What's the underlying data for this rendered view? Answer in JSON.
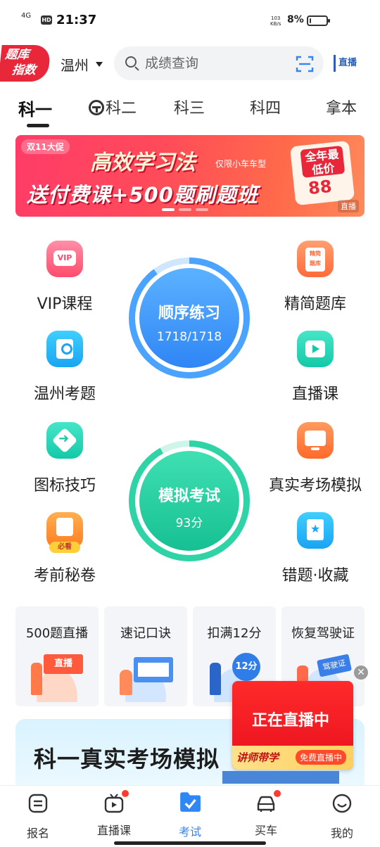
{
  "status_bar": {
    "network": "4G",
    "hd": "HD",
    "time": "21:37",
    "speed_value": "103",
    "speed_unit": "KB/s",
    "battery_pct": "8%",
    "battery_level": 0.08
  },
  "header": {
    "logo_line1": "题库",
    "logo_line2": "指数",
    "city": "温州",
    "search_placeholder": "成绩查询",
    "live_badge": "直播"
  },
  "tabs": [
    {
      "label": "科一",
      "active": true
    },
    {
      "label": "科二",
      "active": false
    },
    {
      "label": "科三",
      "active": false
    },
    {
      "label": "科四",
      "active": false
    },
    {
      "label": "拿本",
      "active": false
    }
  ],
  "banner": {
    "promo_tag": "双11大促",
    "headline": "高效学习法",
    "sub": "仅限小车车型",
    "main_line": "送付费课+500题刷题班",
    "price_title": "全年最低价",
    "price_value": "88",
    "live_mini": "直播"
  },
  "grid": {
    "vip": "VIP课程",
    "jingjian": "精简题库",
    "wenzhou": "温州考题",
    "zhibo": "直播课",
    "tubiao": "图标技巧",
    "zhenshi": "真实考场模拟",
    "kaoqian": "考前秘卷",
    "kaoqian_badge": "必看",
    "cuoti": "错题·收藏"
  },
  "practice": {
    "title": "顺序练习",
    "progress": "1718/1718",
    "done": 1718,
    "total": 1718
  },
  "exam": {
    "title": "模拟考试",
    "score": "93分"
  },
  "cards": [
    {
      "title": "500题直播",
      "art": "直播"
    },
    {
      "title": "速记口诀",
      "art": ""
    },
    {
      "title": "扣满12分",
      "art": "12分"
    },
    {
      "title": "恢复驾驶证",
      "art": "驾驶证"
    }
  ],
  "promo": {
    "title": "科一真实考场模拟"
  },
  "float_live": {
    "head": "正在直播中",
    "teacher": "讲师带学",
    "free": "免费直播中",
    "close": "✕"
  },
  "nav": [
    {
      "label": "报名",
      "icon": "signup-icon",
      "active": false,
      "dot": false
    },
    {
      "label": "直播课",
      "icon": "live-tv-icon",
      "active": false,
      "dot": true
    },
    {
      "label": "考试",
      "icon": "exam-folder-icon",
      "active": true,
      "dot": false
    },
    {
      "label": "买车",
      "icon": "car-icon",
      "active": false,
      "dot": true
    },
    {
      "label": "我的",
      "icon": "smile-icon",
      "active": false,
      "dot": false
    }
  ],
  "colors": {
    "accent": "#2f86f5",
    "brand_red": "#e8283a",
    "green": "#16c092"
  }
}
